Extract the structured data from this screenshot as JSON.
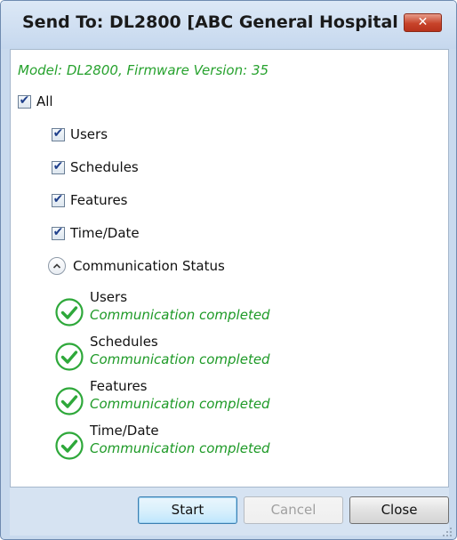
{
  "window": {
    "title": "Send To: DL2800 [ABC General Hospital -...",
    "close_glyph": "✕"
  },
  "model_info": "Model: DL2800, Firmware Version: 35",
  "options": {
    "all": {
      "label": "All",
      "checked": true
    },
    "items": [
      {
        "label": "Users",
        "checked": true
      },
      {
        "label": "Schedules",
        "checked": true
      },
      {
        "label": "Features",
        "checked": true
      },
      {
        "label": "Time/Date",
        "checked": true
      }
    ]
  },
  "communication_status": {
    "label": "Communication Status",
    "expander_icon": "chevron-up-icon",
    "status_icon": "check-circle-icon",
    "items": [
      {
        "name": "Users",
        "message": "Communication completed"
      },
      {
        "name": "Schedules",
        "message": "Communication completed"
      },
      {
        "name": "Features",
        "message": "Communication completed"
      },
      {
        "name": "Time/Date",
        "message": "Communication completed"
      }
    ]
  },
  "buttons": {
    "start": "Start",
    "cancel": "Cancel",
    "close": "Close",
    "cancel_enabled": false
  },
  "colors": {
    "success_green": "#1e9a27",
    "model_green": "#27a22e",
    "title_bar": "#c9daee",
    "close_red": "#c7432a"
  }
}
